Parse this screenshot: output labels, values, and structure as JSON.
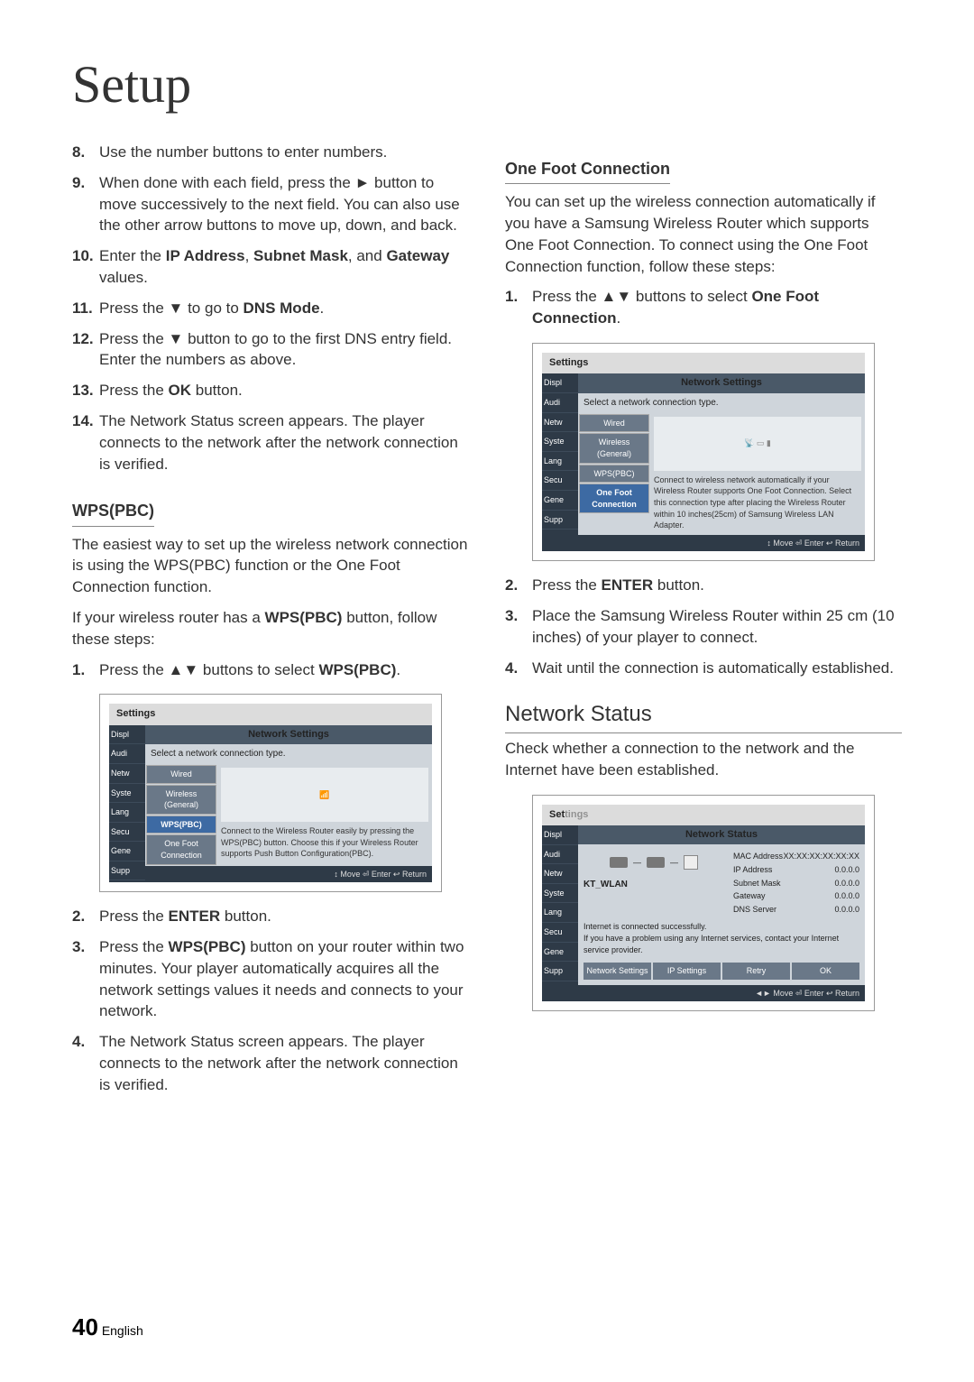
{
  "page_title": "Setup",
  "left": {
    "steps_a": [
      {
        "n": "8.",
        "t": "Use the number buttons to enter numbers."
      },
      {
        "n": "9.",
        "t": "When done with each field, press the ► button to move successively to the next field. You can also use the other arrow buttons to move up, down, and back."
      },
      {
        "n": "10.",
        "t": "Enter the IP Address, Subnet Mask, and Gateway values."
      },
      {
        "n": "11.",
        "t": "Press the ▼ to go to DNS Mode."
      },
      {
        "n": "12.",
        "t": "Press the ▼ button to go to the first DNS entry field. Enter the numbers as above."
      },
      {
        "n": "13.",
        "t": "Press the OK button."
      },
      {
        "n": "14.",
        "t": "The Network Status screen appears. The player connects to the network after the network connection is verified."
      }
    ],
    "subhead1": "WPS(PBC)",
    "para1": "The easiest way to set up the wireless network connection is using the WPS(PBC) function or the One Foot Connection function.",
    "para2": "If your wireless router has a WPS(PBC) button, follow these steps:",
    "steps_b": [
      {
        "n": "1.",
        "t": "Press the ▲▼ buttons to select WPS(PBC)."
      }
    ],
    "steps_c": [
      {
        "n": "2.",
        "t": "Press the ENTER button."
      },
      {
        "n": "3.",
        "t": "Press the WPS(PBC) button on your router within two minutes. Your player automatically acquires all the network settings values it needs and connects to your network."
      },
      {
        "n": "4.",
        "t": "The Network Status screen appears. The player connects to the network after the network connection is verified."
      }
    ]
  },
  "right": {
    "subhead1": "One Foot Connection",
    "para1": "You can set up the wireless connection automatically if you have a Samsung Wireless Router which supports One Foot Connection. To connect using the One Foot Connection function, follow these steps:",
    "steps_a": [
      {
        "n": "1.",
        "t": "Press the ▲▼ buttons to select One Foot Connection."
      }
    ],
    "steps_b": [
      {
        "n": "2.",
        "t": "Press the ENTER button."
      },
      {
        "n": "3.",
        "t": "Place the Samsung Wireless Router within 25 cm (10 inches) of your player to connect."
      },
      {
        "n": "4.",
        "t": "Wait until the connection is automatically established."
      }
    ],
    "section_head": "Network Status",
    "para2": "Check whether a connection to the network and the Internet have been established."
  },
  "osd_common": {
    "settings": "Settings",
    "title": "Network Settings",
    "prompt": "Select a network connection type.",
    "sidebar": [
      "Displ",
      "Audi",
      "Netw",
      "Syste",
      "Lang",
      "Secu",
      "Gene",
      "Supp"
    ],
    "options": [
      "Wired",
      "Wireless (General)",
      "WPS(PBC)",
      "One Foot Connection"
    ],
    "footer": "↕ Move    ⏎ Enter    ↩ Return"
  },
  "osd_wps_desc": "Connect to the Wireless Router easily by pressing the WPS(PBC) button. Choose this if your Wireless Router supports Push Button Configuration(PBC).",
  "osd_onefoot_desc": "Connect to wireless network automatically if your Wireless Router supports One Foot Connection. Select this connection type after placing the Wireless Router within 10 inches(25cm) of Samsung Wireless LAN Adapter.",
  "osd_status": {
    "title": "Network Status",
    "wifi_name": "KT_WLAN",
    "rows": [
      {
        "k": "MAC Address",
        "v": "XX:XX:XX:XX:XX:XX"
      },
      {
        "k": "IP Address",
        "v": "0.0.0.0"
      },
      {
        "k": "Subnet Mask",
        "v": "0.0.0.0"
      },
      {
        "k": "Gateway",
        "v": "0.0.0.0"
      },
      {
        "k": "DNS Server",
        "v": "0.0.0.0"
      }
    ],
    "msg1": "Internet is connected successfully.",
    "msg2": "If you have a problem using any Internet services, contact your Internet service provider.",
    "buttons": [
      "Network Settings",
      "IP Settings",
      "Retry",
      "OK"
    ],
    "footer": "◄► Move    ⏎ Enter    ↩ Return"
  },
  "footer": {
    "num": "40",
    "lang": "English"
  }
}
